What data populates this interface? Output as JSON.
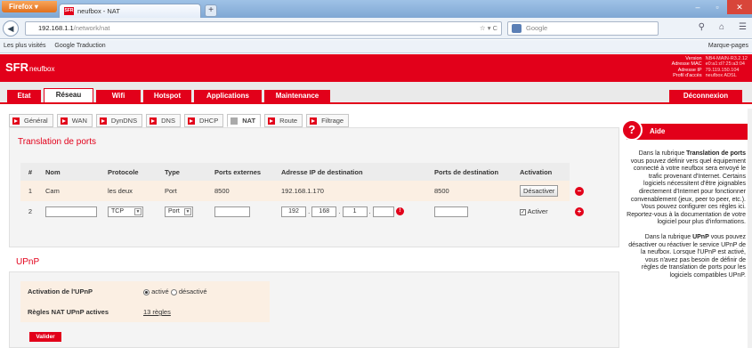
{
  "browser": {
    "app_button": "Firefox ▾",
    "tab_title": "neufbox - NAT",
    "favicon_text": "SFR",
    "url_host": "192.168.1.1",
    "url_path": "/network/nat",
    "search_placeholder": "Google",
    "bookmarks": [
      "Les plus visités",
      "Google Traduction"
    ],
    "bookmarks_menu": "Marque-pages"
  },
  "header": {
    "logo": "SFR",
    "product": "neufbox",
    "info": [
      {
        "k": "Version",
        "v": "NB4-MAIN-R3.2.12"
      },
      {
        "k": "Adresse MAC",
        "v": "e0:a1:d7:25:a3:04"
      },
      {
        "k": "Adresse IP",
        "v": "79.119.150.104"
      },
      {
        "k": "Profil d'accès",
        "v": "neufbox ADSL"
      }
    ]
  },
  "menu": {
    "items": [
      "Etat",
      "Réseau",
      "Wifi",
      "Hotspot",
      "Applications",
      "Maintenance"
    ],
    "active": "Réseau",
    "logout": "Déconnexion"
  },
  "subtabs": [
    "Général",
    "WAN",
    "DynDNS",
    "DNS",
    "DHCP",
    "NAT",
    "Route",
    "Filtrage"
  ],
  "nat": {
    "title": "Translation de ports",
    "columns": [
      "#",
      "Nom",
      "Protocole",
      "Type",
      "Ports externes",
      "Adresse IP de destination",
      "Ports de destination",
      "Activation"
    ],
    "rows": [
      {
        "num": "1",
        "name": "Cam",
        "protocol": "les deux",
        "type": "Port",
        "ext_ports": "8500",
        "ip": "192.168.1.170",
        "dest_ports": "8500",
        "action": "Désactiver"
      }
    ],
    "new_row": {
      "num": "2",
      "protocol": "TCP",
      "type": "Port",
      "ip_parts": [
        "192",
        "168",
        "1",
        ""
      ],
      "activate_label": "Activer"
    }
  },
  "upnp": {
    "title": "UPnP",
    "activation_label": "Activation de l'UPnP",
    "opt_on": "activé",
    "opt_off": "désactivé",
    "rules_label": "Règles NAT UPnP actives",
    "rules_link": "13 règles",
    "submit": "Valider"
  },
  "aide": {
    "title": "Aide",
    "p1_pre": "Dans la rubrique ",
    "p1_bold": "Translation de ports",
    "p1_post": " vous pouvez définir vers quel équipement connecté à votre neufbox sera envoyé le trafic provenant d'Internet. Certains logiciels nécessitent d'être joignables directement d'Internet pour fonctionner convenablement (jeux, peer to peer, etc.). Vous pouvez configurer ces règles ici. Reportez-vous à la documentation de votre logiciel pour plus d'informations.",
    "p2_pre": "Dans la rubrique ",
    "p2_bold": "UPnP",
    "p2_post": " vous pouvez désactiver ou réactiver le service UPnP de la neufbox. Lorsque l'UPnP est activé, vous n'avez pas besoin de définir de règles de translation de ports pour les logiciels compatibles UPnP."
  }
}
